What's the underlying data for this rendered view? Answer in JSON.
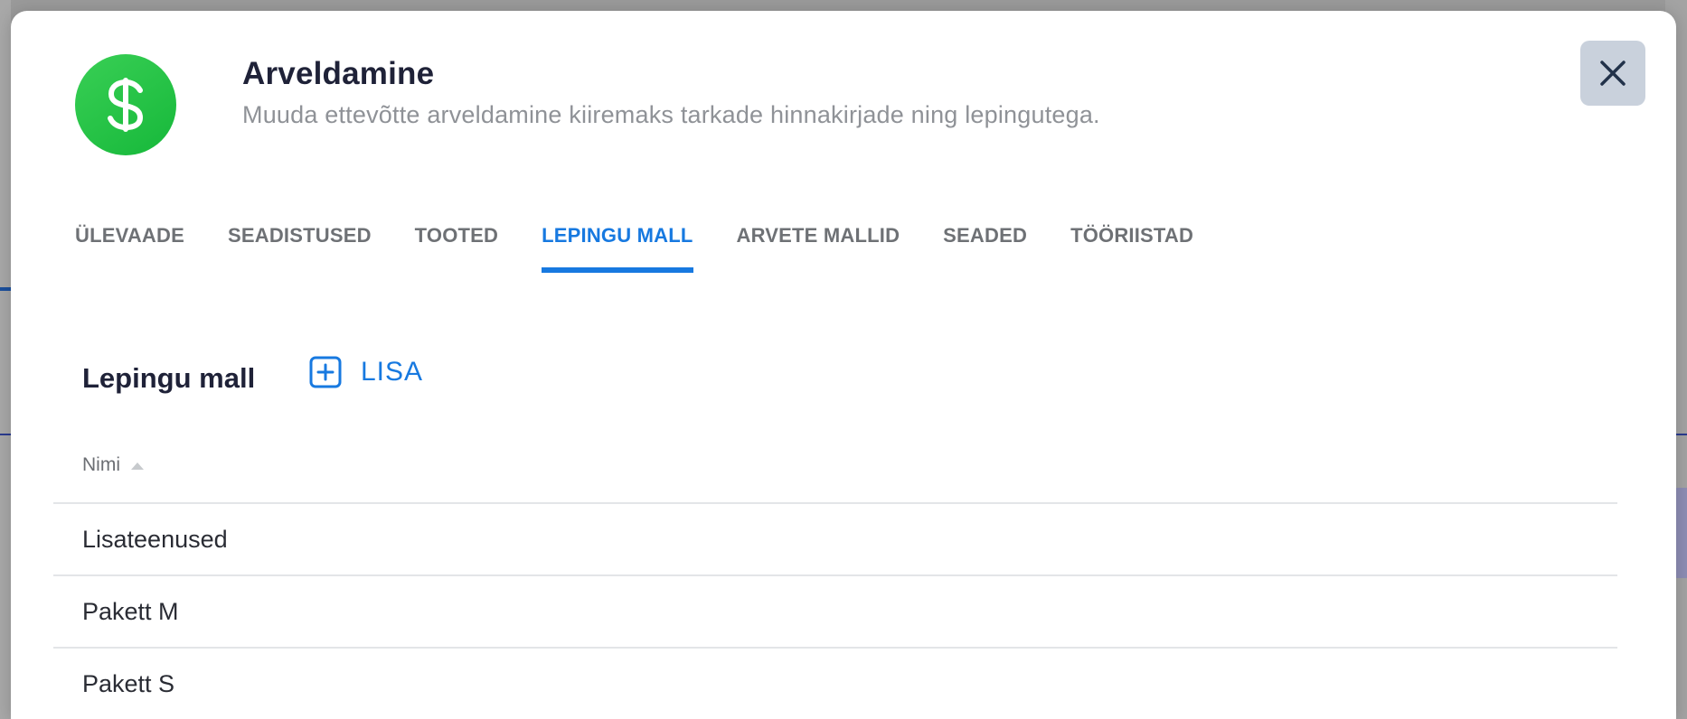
{
  "modal": {
    "icon": "dollar-icon",
    "title": "Arveldamine",
    "subtitle": "Muuda ettevõtte arveldamine kiiremaks tarkade hinnakirjade ning lepingutega.",
    "close_icon": "close-icon"
  },
  "tabs": [
    {
      "label": "ÜLEVAADE",
      "active": false
    },
    {
      "label": "SEADISTUSED",
      "active": false
    },
    {
      "label": "TOOTED",
      "active": false
    },
    {
      "label": "LEPINGU MALL",
      "active": true
    },
    {
      "label": "ARVETE MALLID",
      "active": false
    },
    {
      "label": "SEADED",
      "active": false
    },
    {
      "label": "TÖÖRIISTAD",
      "active": false
    }
  ],
  "section": {
    "title": "Lepingu mall",
    "add_label": "LISA",
    "add_icon": "plus-square-icon"
  },
  "table": {
    "column_name": "Nimi",
    "sort_icon": "sort-asc-icon",
    "rows": [
      {
        "name": "Lisateenused"
      },
      {
        "name": "Pakett M"
      },
      {
        "name": "Pakett S"
      }
    ]
  },
  "colors": {
    "accent": "#1779e0",
    "icon_green": "#22c444",
    "close_bg": "#c9d1dc"
  }
}
